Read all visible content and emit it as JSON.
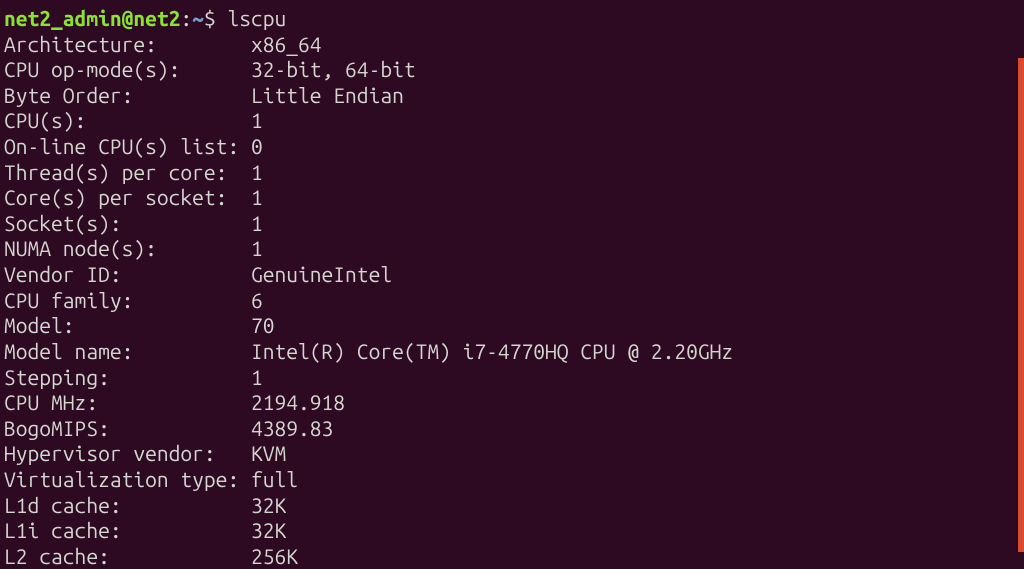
{
  "prompt": {
    "user_host": "net2_admin@net2",
    "colon": ":",
    "path": "~",
    "dollar": "$ ",
    "command": "lscpu"
  },
  "output": [
    {
      "label": "Architecture:        ",
      "value": "x86_64"
    },
    {
      "label": "CPU op-mode(s):      ",
      "value": "32-bit, 64-bit"
    },
    {
      "label": "Byte Order:          ",
      "value": "Little Endian"
    },
    {
      "label": "CPU(s):              ",
      "value": "1"
    },
    {
      "label": "On-line CPU(s) list: ",
      "value": "0"
    },
    {
      "label": "Thread(s) per core:  ",
      "value": "1"
    },
    {
      "label": "Core(s) per socket:  ",
      "value": "1"
    },
    {
      "label": "Socket(s):           ",
      "value": "1"
    },
    {
      "label": "NUMA node(s):        ",
      "value": "1"
    },
    {
      "label": "Vendor ID:           ",
      "value": "GenuineIntel"
    },
    {
      "label": "CPU family:          ",
      "value": "6"
    },
    {
      "label": "Model:               ",
      "value": "70"
    },
    {
      "label": "Model name:          ",
      "value": "Intel(R) Core(TM) i7-4770HQ CPU @ 2.20GHz"
    },
    {
      "label": "Stepping:            ",
      "value": "1"
    },
    {
      "label": "CPU MHz:             ",
      "value": "2194.918"
    },
    {
      "label": "BogoMIPS:            ",
      "value": "4389.83"
    },
    {
      "label": "Hypervisor vendor:   ",
      "value": "KVM"
    },
    {
      "label": "Virtualization type: ",
      "value": "full"
    },
    {
      "label": "L1d cache:           ",
      "value": "32K"
    },
    {
      "label": "L1i cache:           ",
      "value": "32K"
    },
    {
      "label": "L2 cache:            ",
      "value": "256K"
    }
  ]
}
